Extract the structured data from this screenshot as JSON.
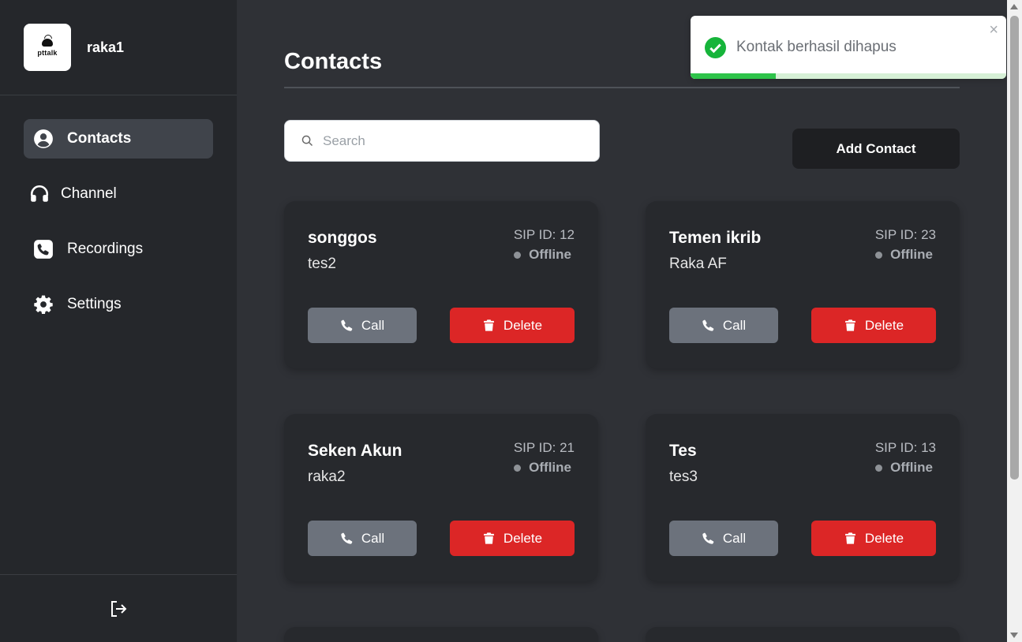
{
  "sidebar": {
    "logo_text": "pttalk",
    "username": "raka1",
    "items": [
      {
        "label": "Contacts",
        "icon": "user-circle-icon",
        "active": true
      },
      {
        "label": "Channel",
        "icon": "headphones-icon",
        "active": false
      },
      {
        "label": "Recordings",
        "icon": "phone-square-icon",
        "active": false
      },
      {
        "label": "Settings",
        "icon": "gear-icon",
        "active": false
      }
    ],
    "logout_icon": "logout-icon"
  },
  "main": {
    "title": "Contacts",
    "search_placeholder": "Search",
    "add_contact_label": "Add Contact",
    "call_label": "Call",
    "delete_label": "Delete",
    "contacts": [
      {
        "name": "songgos",
        "username": "tes2",
        "sip": "SIP ID: 12",
        "status": "Offline"
      },
      {
        "name": "Temen ikrib",
        "username": "Raka AF",
        "sip": "SIP ID: 23",
        "status": "Offline"
      },
      {
        "name": "Seken Akun",
        "username": "raka2",
        "sip": "SIP ID: 21",
        "status": "Offline"
      },
      {
        "name": "Tes",
        "username": "tes3",
        "sip": "SIP ID: 13",
        "status": "Offline"
      }
    ]
  },
  "toast": {
    "message": "Kontak berhasil dihapus",
    "close": "×",
    "progress": 0.27
  },
  "colors": {
    "accent_delete": "#dc2626",
    "call_button": "#6c727c",
    "success": "#2ec34a"
  }
}
